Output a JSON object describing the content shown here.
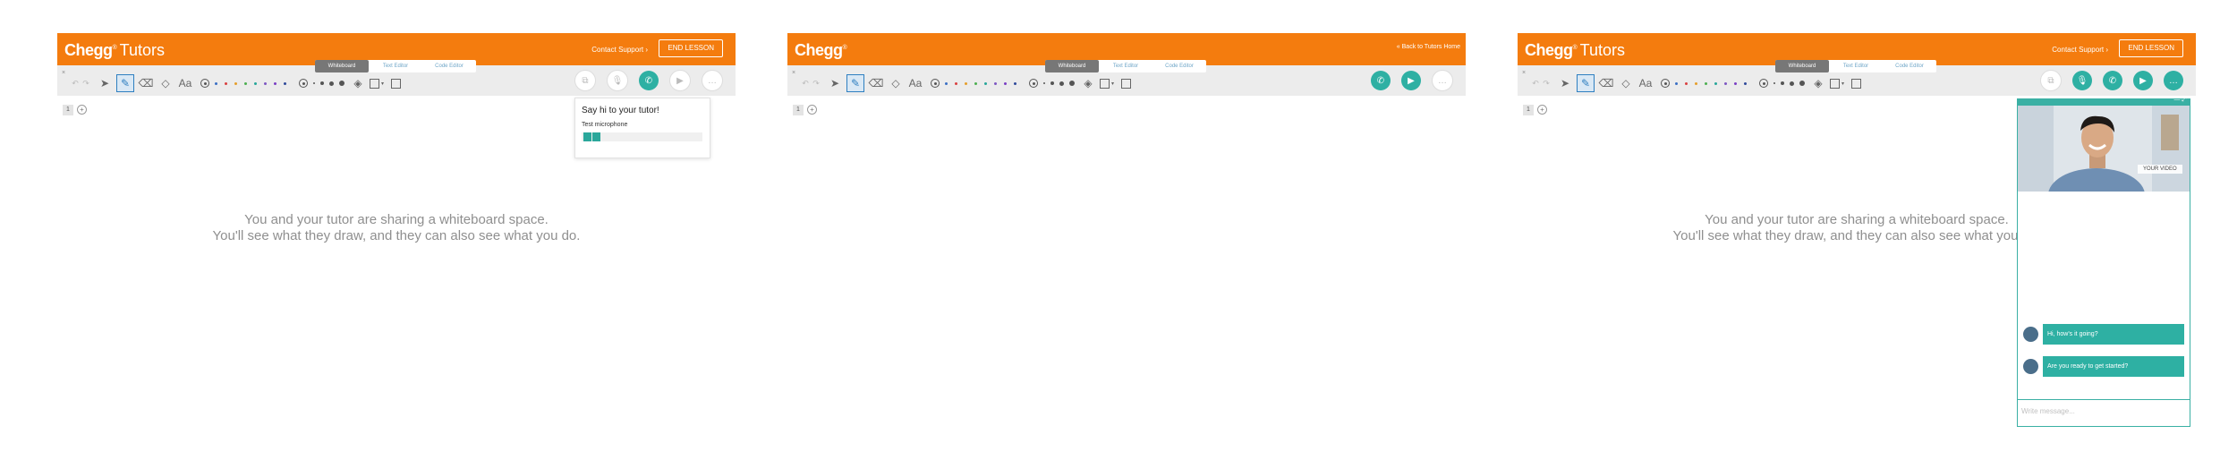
{
  "brand": {
    "name": "Chegg",
    "product": "Tutors"
  },
  "header": {
    "contact_label": "Contact Support",
    "end_lesson_label": "END LESSON",
    "back_label": "« Back to Tutors Home"
  },
  "tabs": [
    "Whiteboard",
    "Text Editor",
    "Code Editor"
  ],
  "toolbar": {
    "text_tool_label": "Aa",
    "palette": [
      "#3a6fc4",
      "#d94040",
      "#e59e2a",
      "#4caf50",
      "#26a69a",
      "#7e57c2",
      "#7a3ec4",
      "#2f4a9a"
    ]
  },
  "page": {
    "number": "1"
  },
  "whiteboard": {
    "line1": "You and your tutor are sharing a whiteboard space.",
    "line2": "You'll see what they draw, and they can also see what you do."
  },
  "mic_popup": {
    "title": "Say hi to your tutor!",
    "test_label": "Test microphone"
  },
  "video": {
    "your_video_label": "YOUR VIDEO",
    "messages": [
      "Hi, how's it going?",
      "Are you ready to get started?"
    ],
    "input_placeholder": "Write message..."
  },
  "colors": {
    "brand": "#f47c0e",
    "teal": "#2eb0a3",
    "toolbar": "#ececec"
  }
}
